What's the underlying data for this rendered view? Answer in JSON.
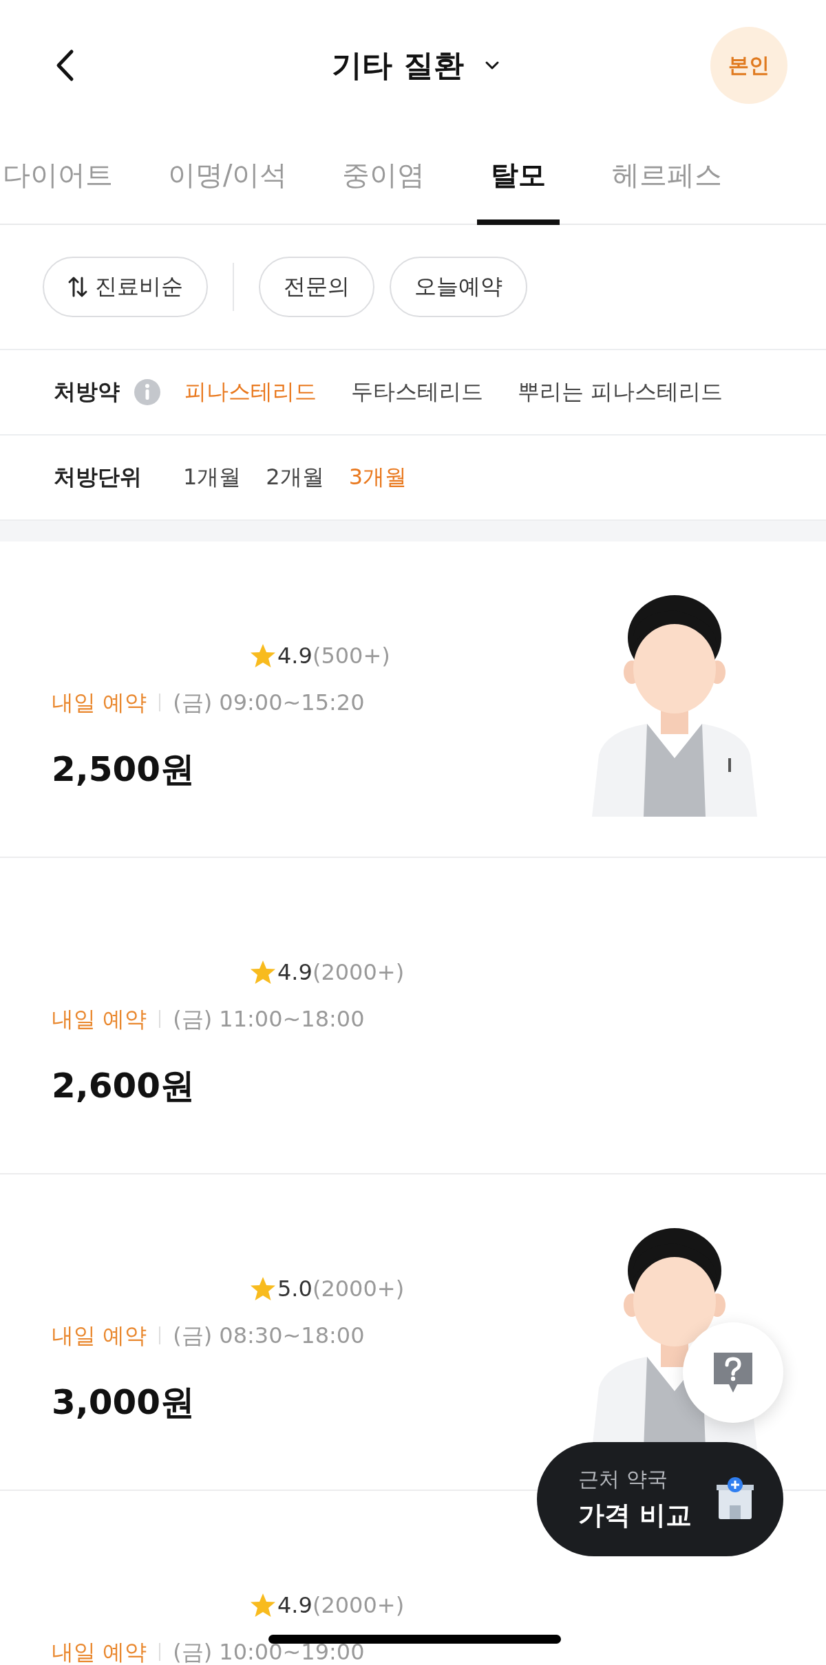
{
  "header": {
    "title": "기타 질환",
    "profile_badge": "본인"
  },
  "tabs": [
    {
      "label": "다이어트",
      "selected": false
    },
    {
      "label": "이명/이석",
      "selected": false
    },
    {
      "label": "중이염",
      "selected": false
    },
    {
      "label": "탈모",
      "selected": true
    },
    {
      "label": "헤르페스",
      "selected": false
    }
  ],
  "chips": [
    {
      "label": "진료비순",
      "kind": "sort"
    },
    {
      "label": "전문의",
      "kind": "toggle"
    },
    {
      "label": "오늘예약",
      "kind": "toggle"
    }
  ],
  "filters": [
    {
      "label": "처방약",
      "info": true,
      "options": [
        {
          "label": "피나스테리드",
          "selected": true
        },
        {
          "label": "두타스테리드",
          "selected": false
        },
        {
          "label": "뿌리는 피나스테리드",
          "selected": false
        }
      ]
    },
    {
      "label": "처방단위",
      "info": false,
      "options": [
        {
          "label": "1개월",
          "selected": false
        },
        {
          "label": "2개월",
          "selected": false
        },
        {
          "label": "3개월",
          "selected": true
        }
      ]
    }
  ],
  "clinics": [
    {
      "rating": "4.9",
      "reviews": "(500+)",
      "availability": "내일 예약",
      "hours": "(금) 09:00~15:20",
      "price": "2,500원",
      "illustration": true
    },
    {
      "rating": "4.9",
      "reviews": "(2000+)",
      "availability": "내일 예약",
      "hours": "(금) 11:00~18:00",
      "price": "2,600원",
      "illustration": false
    },
    {
      "rating": "5.0",
      "reviews": "(2000+)",
      "availability": "내일 예약",
      "hours": "(금) 08:30~18:00",
      "price": "3,000원",
      "illustration": true
    },
    {
      "rating": "4.9",
      "reviews": "(2000+)",
      "availability": "내일 예약",
      "hours": "(금) 10:00~19:00",
      "illustration": false
    }
  ],
  "pharmacy_button": {
    "caption": "근처 약국",
    "label": "가격 비교"
  }
}
